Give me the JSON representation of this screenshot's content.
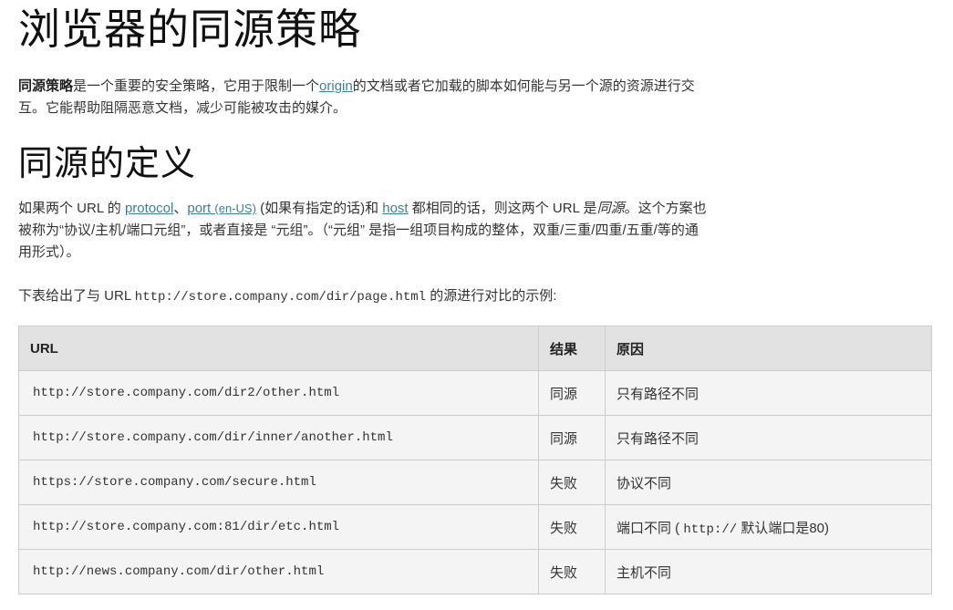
{
  "title": "浏览器的同源策略",
  "intro": {
    "bold": "同源策略",
    "text1": "是一个重要的安全策略，它用于限制一个",
    "link": "origin",
    "text2": "的文档或者它加载的脚本如何能与另一个源的资源进行交互。它能帮助阻隔恶意文档，减少可能被攻击的媒介。"
  },
  "definition": {
    "heading": "同源的定义",
    "t1": "如果两个 URL 的 ",
    "link_protocol": "protocol",
    "t2": "、",
    "link_port": "port",
    "link_enus": "(en-US)",
    "t3": " (如果有指定的话)和 ",
    "link_host": "host",
    "t4": " 都相同的话，则这两个 URL 是",
    "same_origin_em": "同源",
    "t5": "。这个方案也被称为“协议/主机/端口元组”，或者直接是 “元组”。（“元组” 是指一组项目构成的整体，双重/三重/四重/五重/等的通用形式）。"
  },
  "table_intro": {
    "t1": "下表给出了与 URL ",
    "code": "http://store.company.com/dir/page.html",
    "t2": " 的源进行对比的示例:"
  },
  "table": {
    "headers": [
      "URL",
      "结果",
      "原因"
    ],
    "rows": [
      {
        "url": "http://store.company.com/dir2/other.html",
        "result": "同源",
        "reason": "只有路径不同"
      },
      {
        "url": "http://store.company.com/dir/inner/another.html",
        "result": "同源",
        "reason": "只有路径不同"
      },
      {
        "url": "https://store.company.com/secure.html",
        "result": "失败",
        "reason": "协议不同"
      },
      {
        "url": "http://store.company.com:81/dir/etc.html",
        "result": "失败",
        "reason_pre": "端口不同 ( ",
        "reason_code": "http://",
        "reason_post": " 默认端口是80)"
      },
      {
        "url": "http://news.company.com/dir/other.html",
        "result": "失败",
        "reason": "主机不同"
      }
    ]
  }
}
